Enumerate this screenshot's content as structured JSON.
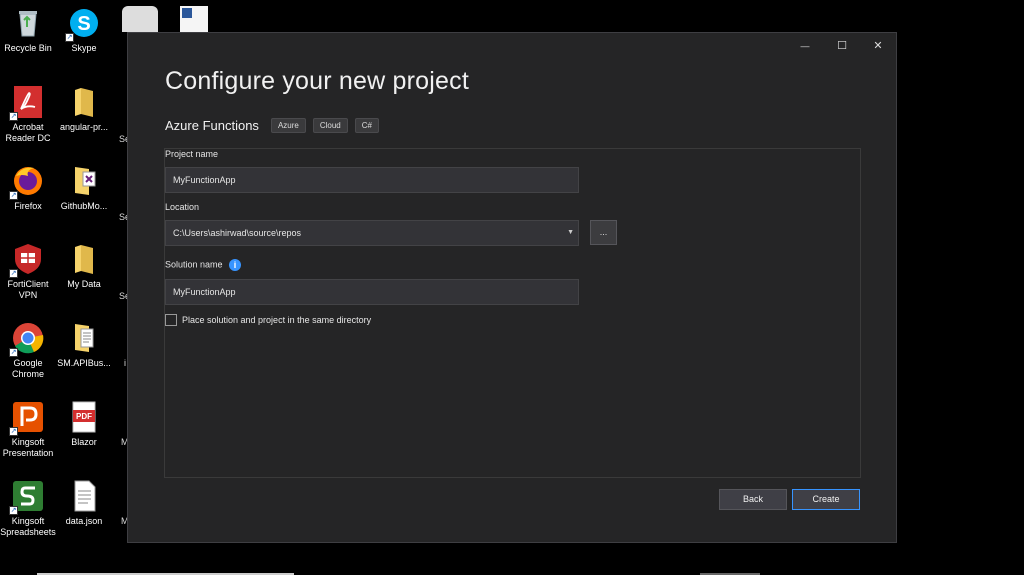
{
  "desktop": {
    "icons": [
      {
        "label": "Recycle Bin",
        "icon": "recycle-bin-icon"
      },
      {
        "label": "Skype",
        "icon": "skype-icon"
      },
      {
        "label": "Acrobat Reader DC",
        "line1": "Acrobat",
        "line2": "Reader DC",
        "icon": "acrobat-icon"
      },
      {
        "label": "angular-pr...",
        "icon": "folder-icon"
      },
      {
        "label": "Firefox",
        "icon": "firefox-icon"
      },
      {
        "label": "GithubMo...",
        "icon": "visual-studio-file-icon"
      },
      {
        "label": "FortiClient VPN",
        "line1": "FortiClient",
        "line2": "VPN",
        "icon": "forticlient-icon"
      },
      {
        "label": "My Data",
        "icon": "folder-icon"
      },
      {
        "label": "Google Chrome",
        "line1": "Google",
        "line2": "Chrome",
        "icon": "chrome-icon"
      },
      {
        "label": "SM.APIBus...",
        "icon": "file-icon"
      },
      {
        "label": "Kingsoft Presentation",
        "line1": "Kingsoft",
        "line2": "Presentation",
        "icon": "kingsoft-presentation-icon"
      },
      {
        "label": "Blazor",
        "icon": "pdf-icon"
      },
      {
        "label": "Kingsoft Spreadsheets",
        "line1": "Kingsoft",
        "line2": "Spreadsheets",
        "icon": "kingsoft-spreadsheets-icon"
      },
      {
        "label": "data.json",
        "icon": "file-icon"
      }
    ],
    "peeks": [
      "Se",
      "Se",
      "Se",
      "i",
      "M",
      "M"
    ],
    "pdf_badge": "PDF"
  },
  "dialog": {
    "title": "Configure your new project",
    "template_name": "Azure Functions",
    "tags": [
      "Azure",
      "Cloud",
      "C#"
    ],
    "project_name_label": "Project name",
    "project_name_value": "MyFunctionApp",
    "location_label": "Location",
    "location_value": "C:\\Users\\ashirwad\\source\\repos",
    "browse_label": "...",
    "solution_name_label": "Solution name",
    "solution_name_value": "MyFunctionApp",
    "info_glyph": "i",
    "same_dir_label": "Place solution and project in the same directory",
    "same_dir_checked": false,
    "back_label": "Back",
    "create_label": "Create",
    "minimize_glyph": "—",
    "maximize_glyph": "☐",
    "close_glyph": "✕"
  },
  "colors": {
    "dialog_bg": "#252526",
    "accent": "#3794ff",
    "input_bg": "#333337"
  }
}
